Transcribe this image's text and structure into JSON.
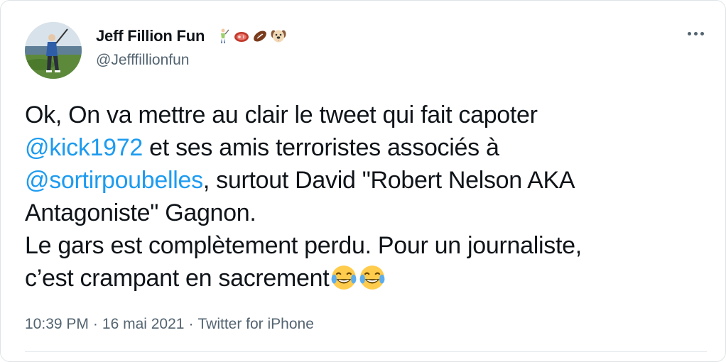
{
  "user": {
    "display_name": "Jeff Fillion Fun",
    "handle": "@Jefffillionfun",
    "name_emojis": [
      "golfer-emoji",
      "steak-emoji",
      "football-emoji",
      "dog-face-emoji"
    ]
  },
  "tweet": {
    "line1": "Ok, On va mettre au clair le tweet qui fait capoter",
    "mention1": "@kick1972",
    "line2_rest": " et ses amis terroristes associés à",
    "mention2": "@sortirpoubelles",
    "line3_rest": ", surtout David \"Robert Nelson AKA",
    "line4": "Antagoniste\" Gagnon.",
    "line5": "Le gars est complètement perdu. Pour un journaliste,",
    "line6": "c’est crampant en sacrement",
    "trailing_emojis": [
      "face-with-tears-of-joy-emoji",
      "face-with-tears-of-joy-emoji"
    ]
  },
  "meta": {
    "time": "10:39 PM",
    "date": "16 mai 2021",
    "separator": "·",
    "source": "Twitter for iPhone"
  },
  "colors": {
    "text": "#0f1419",
    "secondary": "#536471",
    "mention": "#1d9bf0",
    "border": "#dfe3e6"
  }
}
